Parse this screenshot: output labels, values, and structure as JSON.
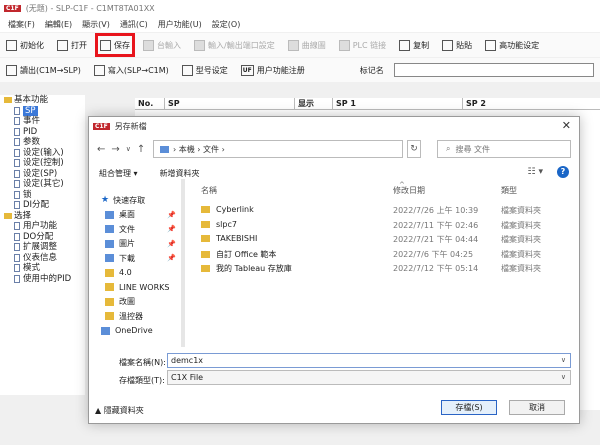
{
  "window": {
    "logo": "C1F",
    "title": "(无题) - SLP-C1F - C1MT8TA01XX"
  },
  "menu": [
    "檔案(F)",
    "編輯(E)",
    "顯示(V)",
    "通訊(C)",
    "用户功能(U)",
    "設定(O)"
  ],
  "toolbar1": [
    {
      "label": "初始化",
      "disabled": false,
      "highlight": false
    },
    {
      "label": "打开",
      "disabled": false,
      "highlight": false
    },
    {
      "label": "保存",
      "disabled": false,
      "highlight": true
    },
    {
      "label": "台輸入",
      "disabled": true,
      "highlight": false
    },
    {
      "label": "輸入/輸出端口設定",
      "disabled": true,
      "highlight": false
    },
    {
      "label": "曲線圖",
      "disabled": true,
      "highlight": false
    },
    {
      "label": "PLC 链接",
      "disabled": true,
      "highlight": false
    },
    {
      "label": "复制",
      "disabled": false,
      "highlight": false
    },
    {
      "label": "貼貼",
      "disabled": false,
      "highlight": false
    },
    {
      "label": "高功能设定",
      "disabled": false,
      "highlight": false
    }
  ],
  "toolbar2": [
    {
      "label": "讀出(C1M→SLP)"
    },
    {
      "label": "寫入(SLP→C1M)"
    },
    {
      "label": "型号设定"
    },
    {
      "label": "用户功能注册",
      "icon_text": "UF"
    }
  ],
  "name_field": {
    "label": "标记名",
    "value": ""
  },
  "tree": [
    {
      "label": "基本功能",
      "level": 0,
      "type": "folder",
      "selected": false
    },
    {
      "label": "SP",
      "level": 1,
      "type": "doc",
      "selected": true
    },
    {
      "label": "事件",
      "level": 1,
      "type": "doc",
      "selected": false
    },
    {
      "label": "PID",
      "level": 1,
      "type": "doc",
      "selected": false
    },
    {
      "label": "参数",
      "level": 1,
      "type": "doc",
      "selected": false
    },
    {
      "label": "设定(输入)",
      "level": 1,
      "type": "doc",
      "selected": false
    },
    {
      "label": "设定(控制)",
      "level": 1,
      "type": "doc",
      "selected": false
    },
    {
      "label": "设定(SP)",
      "level": 1,
      "type": "doc",
      "selected": false
    },
    {
      "label": "设定(其它)",
      "level": 1,
      "type": "doc",
      "selected": false
    },
    {
      "label": "锁",
      "level": 1,
      "type": "doc",
      "selected": false
    },
    {
      "label": "DI分配",
      "level": 1,
      "type": "doc",
      "selected": false
    },
    {
      "label": "选择",
      "level": 0,
      "type": "folder",
      "selected": false
    },
    {
      "label": "用户功能",
      "level": 1,
      "type": "doc",
      "selected": false
    },
    {
      "label": "DO分配",
      "level": 1,
      "type": "doc",
      "selected": false
    },
    {
      "label": "扩展调整",
      "level": 1,
      "type": "doc",
      "selected": false
    },
    {
      "label": "仪表信息",
      "level": 1,
      "type": "doc",
      "selected": false
    },
    {
      "label": "模式",
      "level": 1,
      "type": "doc",
      "selected": false
    },
    {
      "label": "使用中的PID",
      "level": 1,
      "type": "doc",
      "selected": false
    }
  ],
  "grid_columns": [
    "No.",
    "SP",
    "显示",
    "SP 1",
    "SP 2"
  ],
  "dialog": {
    "logo": "C1F",
    "title": "另存新檔",
    "close": "✕",
    "breadcrumb": "›  本機  ›  文件  ›",
    "search_placeholder": "搜尋 文件",
    "organize": "組合管理 ▾",
    "new_folder": "新增資料夾",
    "view": "☷ ▾",
    "help": "?",
    "nav": [
      {
        "label": "快速存取",
        "icon": "star-icon"
      },
      {
        "label": "桌面",
        "icon": "desktop-icon",
        "pinned": true
      },
      {
        "label": "文件",
        "icon": "documents-icon",
        "pinned": true
      },
      {
        "label": "圖片",
        "icon": "pictures-icon",
        "pinned": true
      },
      {
        "label": "下載",
        "icon": "downloads-icon",
        "pinned": true
      },
      {
        "label": "4.0",
        "icon": "folder-icon"
      },
      {
        "label": "LINE WORKS",
        "icon": "folder-icon"
      },
      {
        "label": "改圖",
        "icon": "folder-icon"
      },
      {
        "label": "溫控器",
        "icon": "folder-icon"
      },
      {
        "label": "OneDrive",
        "icon": "cloud-icon"
      }
    ],
    "file_headers": {
      "name": "名稱",
      "date": "修改日期",
      "type": "類型",
      "sort": "^"
    },
    "files": [
      {
        "name": "Cyberlink",
        "date": "2022/7/26 上午 10:39",
        "type": "檔案資料夾"
      },
      {
        "name": "slpc7",
        "date": "2022/7/11 下午 02:46",
        "type": "檔案資料夾"
      },
      {
        "name": "TAKEBISHI",
        "date": "2022/7/21 下午 04:44",
        "type": "檔案資料夾"
      },
      {
        "name": "自訂 Office 範本",
        "date": "2022/7/6 下午 04:25",
        "type": "檔案資料夾"
      },
      {
        "name": "我的 Tableau 存放庫",
        "date": "2022/7/12 下午 05:14",
        "type": "檔案資料夾"
      }
    ],
    "filename_label": "檔案名稱(N):",
    "filename_value": "demc1x",
    "filetype_label": "存檔類型(T):",
    "filetype_value": "C1X File",
    "hide_folders": "▲ 隱藏資料夾",
    "save": "存檔(S)",
    "cancel": "取消"
  },
  "colors": {
    "highlight": "#e8141c",
    "accent": "#1a66c7",
    "folder": "#e6b93a"
  }
}
